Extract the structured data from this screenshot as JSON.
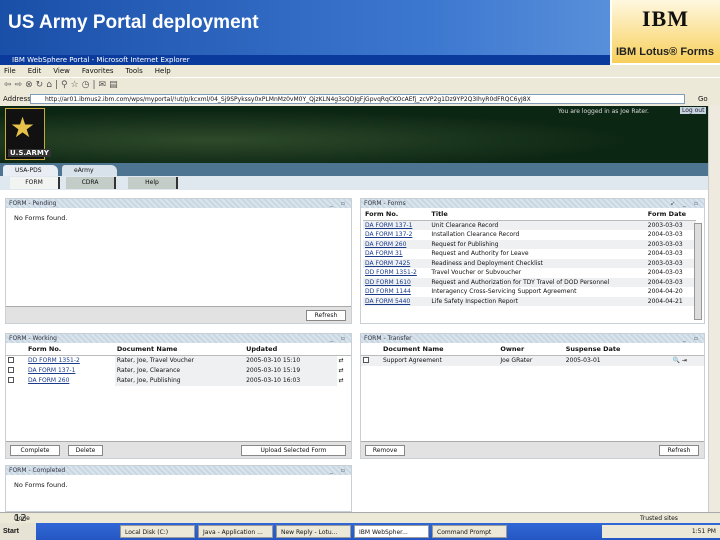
{
  "slide": {
    "title": "US Army Portal deployment",
    "page_number": "12",
    "logo_text": "IBM",
    "product": "IBM Lotus® Forms"
  },
  "window": {
    "title": "IBM WebSphere Portal - Microsoft Internet Explorer"
  },
  "menu": [
    "File",
    "Edit",
    "View",
    "Favorites",
    "Tools",
    "Help"
  ],
  "address": {
    "label": "Address",
    "url": "http://ar01.ibmus2.ibm.com/wps/myportal/!ut/p/kcxml/04_Sj9SPykssy0xPLMnMz0vM0Y_QjzKLN4g3sQDJgFjGpvqRqCKOcAEfj_zcVP2g1Dz9YP2Q3IhyR0dFRQC6yJ8X",
    "go": "Go"
  },
  "banner": {
    "login_text": "You are logged in as Joe Rater.",
    "logout": "Log out",
    "army_text": "U.S.ARMY"
  },
  "tabs": [
    "USA-PDS",
    "eArmy"
  ],
  "subtabs": [
    "FORM",
    "CDRA",
    "Help"
  ],
  "pending": {
    "title": "FORM - Pending",
    "empty": "No Forms found.",
    "refresh": "Refresh"
  },
  "forms": {
    "title": "FORM - Forms",
    "headers": [
      "Form No.",
      "Title",
      "Form Date"
    ],
    "rows": [
      {
        "no": "DA FORM 137-1",
        "title": "Unit Clearance Record",
        "date": "2003-03-03"
      },
      {
        "no": "DA FORM 137-2",
        "title": "Installation Clearance Record",
        "date": "2004-03-03"
      },
      {
        "no": "DA FORM 260",
        "title": "Request for Publishing",
        "date": "2003-03-03"
      },
      {
        "no": "DA FORM 31",
        "title": "Request and Authority for Leave",
        "date": "2004-03-03"
      },
      {
        "no": "DA FORM 7425",
        "title": "Readiness and Deployment Checklist",
        "date": "2003-03-03"
      },
      {
        "no": "DD FORM 1351-2",
        "title": "Travel Voucher or Subvoucher",
        "date": "2004-03-03"
      },
      {
        "no": "DD FORM 1610",
        "title": "Request and Authorization for TDY Travel of DOD Personnel",
        "date": "2004-03-03"
      },
      {
        "no": "DD FORM 1144",
        "title": "Interagency Cross-Servicing Support Agreement",
        "date": "2004-04-20"
      },
      {
        "no": "DA FORM 5440",
        "title": "Life Safety Inspection Report",
        "date": "2004-04-21"
      }
    ]
  },
  "working": {
    "title": "FORM - Working",
    "headers": [
      "Form No.",
      "Document Name",
      "Updated"
    ],
    "rows": [
      {
        "no": "DD FORM 1351-2",
        "name": "Rater, Joe, Travel Voucher",
        "updated": "2005-03-10 15:10"
      },
      {
        "no": "DA FORM 137-1",
        "name": "Rater, Joe, Clearance",
        "updated": "2005-03-10 15:19"
      },
      {
        "no": "DA FORM 260",
        "name": "Rater, Joe, Publishing",
        "updated": "2005-03-10 16:03"
      }
    ],
    "buttons": [
      "Complete",
      "Delete",
      "Upload Selected Form"
    ]
  },
  "transfer": {
    "title": "FORM - Transfer",
    "headers": [
      "Document Name",
      "Owner",
      "Suspense Date"
    ],
    "rows": [
      {
        "name": "Support Agreement",
        "owner": "Joe GRater",
        "date": "2005-03-01"
      }
    ],
    "buttons": [
      "Remove",
      "Refresh"
    ]
  },
  "completed": {
    "title": "FORM - Completed",
    "empty": "No Forms found."
  },
  "status": {
    "left": "Done",
    "right": "Trusted sites"
  },
  "taskbar": {
    "start": "Start",
    "items": [
      "Local Disk (C:)",
      "Java - Application ...",
      "New Reply - Lotu...",
      "IBM WebSpher...",
      "Command Prompt"
    ],
    "clock": "1:51 PM"
  }
}
